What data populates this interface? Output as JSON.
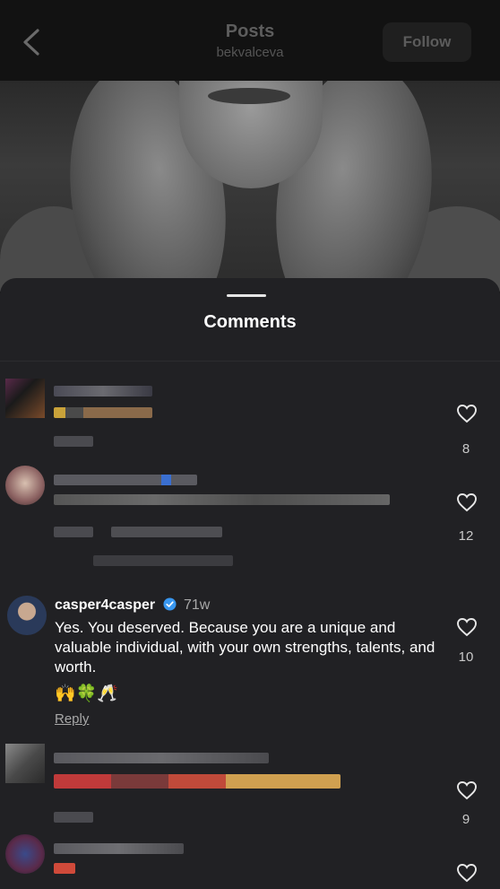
{
  "header": {
    "title": "Posts",
    "username": "bekvalceva",
    "follow_label": "Follow"
  },
  "comments_sheet": {
    "title": "Comments",
    "comments": [
      {
        "redacted": true,
        "like_count": "8"
      },
      {
        "redacted": true,
        "like_count": "12"
      },
      {
        "redacted": false,
        "username": "casper4casper",
        "verified": true,
        "time": "71w",
        "text": "Yes. You deserved. Because you are a unique and valuable individual, with your own strengths, talents, and worth.",
        "emojis": "🙌🍀🥂",
        "reply_label": "Reply",
        "like_count": "10"
      },
      {
        "redacted": true,
        "like_count": "9"
      },
      {
        "redacted": true,
        "like_count": ""
      }
    ]
  },
  "colors": {
    "verified_badge": "#3897f0",
    "sheet_background": "#212124",
    "header_background": "#121212"
  },
  "icons": [
    "back-arrow-icon",
    "heart-outline-icon",
    "verified-badge-icon"
  ]
}
